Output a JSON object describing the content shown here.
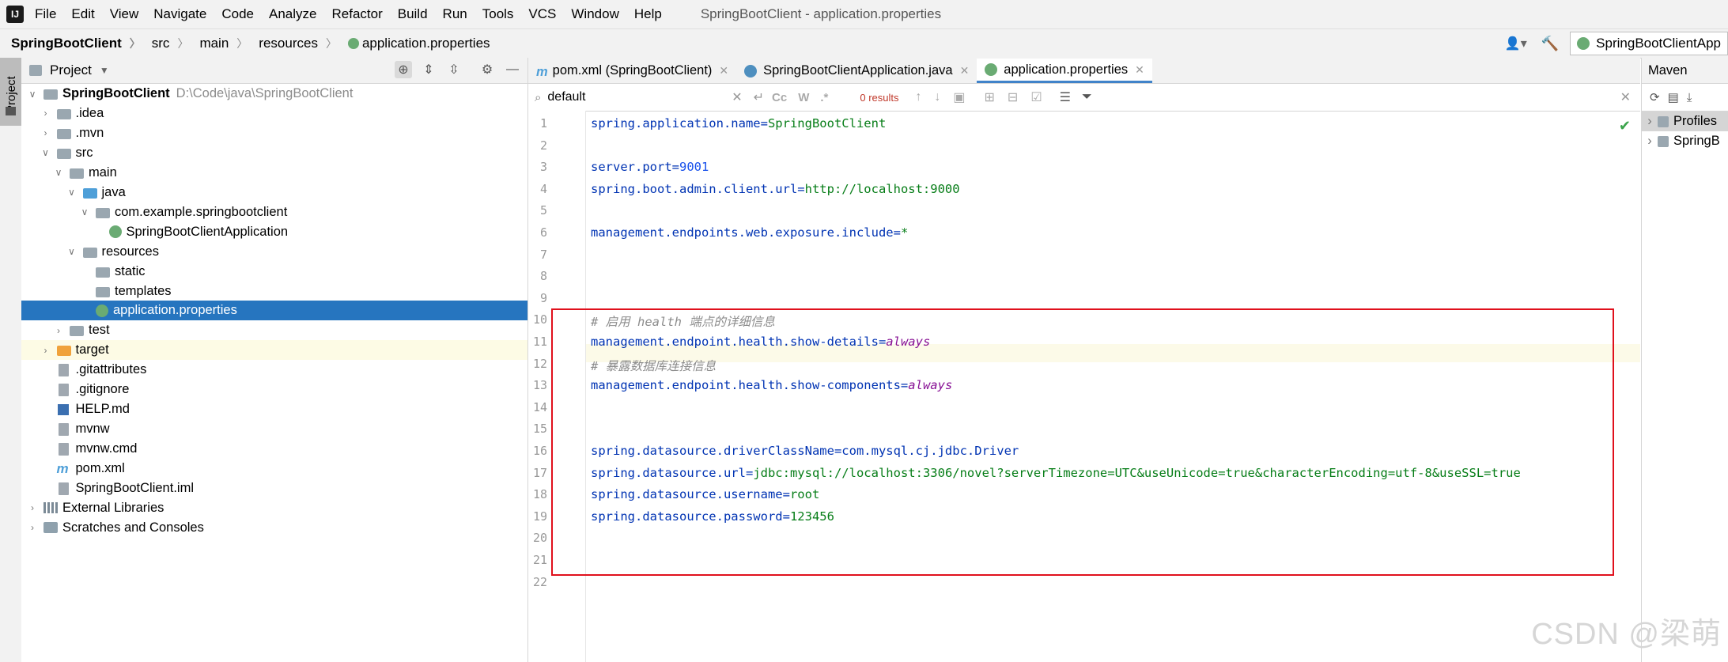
{
  "menubar": {
    "logo": "IJ",
    "items": [
      "File",
      "Edit",
      "View",
      "Navigate",
      "Code",
      "Analyze",
      "Refactor",
      "Build",
      "Run",
      "Tools",
      "VCS",
      "Window",
      "Help"
    ],
    "title": "SpringBootClient - application.properties"
  },
  "breadcrumb": [
    "SpringBootClient",
    "src",
    "main",
    "resources",
    "application.properties"
  ],
  "run_config": "SpringBootClientApp",
  "project_panel": {
    "title": "Project",
    "left_tab": "Project",
    "tree": [
      {
        "label": "SpringBootClient",
        "path": "D:\\Code\\java\\SpringBootClient",
        "depth": 0,
        "arrow": "▾",
        "icon": "folder"
      },
      {
        "label": ".idea",
        "depth": 1,
        "arrow": "▸",
        "icon": "folder"
      },
      {
        "label": ".mvn",
        "depth": 1,
        "arrow": "▸",
        "icon": "folder"
      },
      {
        "label": "src",
        "depth": 1,
        "arrow": "▾",
        "icon": "folder"
      },
      {
        "label": "main",
        "depth": 2,
        "arrow": "▾",
        "icon": "folder"
      },
      {
        "label": "java",
        "depth": 3,
        "arrow": "▾",
        "icon": "folder-blue"
      },
      {
        "label": "com.example.springbootclient",
        "depth": 4,
        "arrow": "▾",
        "icon": "folder"
      },
      {
        "label": "SpringBootClientApplication",
        "depth": 5,
        "arrow": "",
        "icon": "spring-class"
      },
      {
        "label": "resources",
        "depth": 3,
        "arrow": "▾",
        "icon": "folder"
      },
      {
        "label": "static",
        "depth": 4,
        "arrow": "",
        "icon": "folder"
      },
      {
        "label": "templates",
        "depth": 4,
        "arrow": "",
        "icon": "folder"
      },
      {
        "label": "application.properties",
        "depth": 4,
        "arrow": "",
        "icon": "spring-props",
        "selected": true
      },
      {
        "label": "test",
        "depth": 2,
        "arrow": "▸",
        "icon": "folder"
      },
      {
        "label": "target",
        "depth": 1,
        "arrow": "▸",
        "icon": "folder-orange",
        "highlight": true
      },
      {
        "label": ".gitattributes",
        "depth": 1,
        "arrow": "",
        "icon": "file"
      },
      {
        "label": ".gitignore",
        "depth": 1,
        "arrow": "",
        "icon": "file"
      },
      {
        "label": "HELP.md",
        "depth": 1,
        "arrow": "",
        "icon": "md-file"
      },
      {
        "label": "mvnw",
        "depth": 1,
        "arrow": "",
        "icon": "file"
      },
      {
        "label": "mvnw.cmd",
        "depth": 1,
        "arrow": "",
        "icon": "file"
      },
      {
        "label": "pom.xml",
        "depth": 1,
        "arrow": "",
        "icon": "maven-file"
      },
      {
        "label": "SpringBootClient.iml",
        "depth": 1,
        "arrow": "",
        "icon": "file"
      },
      {
        "label": "External Libraries",
        "depth": 0,
        "arrow": "▸",
        "icon": "libraries"
      },
      {
        "label": "Scratches and Consoles",
        "depth": 0,
        "arrow": "▸",
        "icon": "scratches"
      }
    ]
  },
  "tabs": [
    {
      "label": "pom.xml (SpringBootClient)",
      "icon": "maven-icon",
      "active": false
    },
    {
      "label": "SpringBootClientApplication.java",
      "icon": "spring-class-icon",
      "active": false
    },
    {
      "label": "application.properties",
      "icon": "spring-props-icon",
      "active": true
    }
  ],
  "find": {
    "value": "default",
    "results": "0 results",
    "toggles": [
      "Cc",
      "W",
      ".*"
    ]
  },
  "code_lines": [
    {
      "n": "1",
      "parts": [
        [
          "key",
          "spring.application.name="
        ],
        [
          "val",
          "SpringBootClient"
        ]
      ]
    },
    {
      "n": "2",
      "parts": []
    },
    {
      "n": "3",
      "parts": [
        [
          "key",
          "server.port="
        ],
        [
          "num",
          "9001"
        ]
      ]
    },
    {
      "n": "4",
      "parts": [
        [
          "key",
          "spring.boot.admin.client.url="
        ],
        [
          "val",
          "http://localhost:9000"
        ]
      ]
    },
    {
      "n": "5",
      "parts": []
    },
    {
      "n": "6",
      "parts": [
        [
          "key",
          "management.endpoints.web.exposure.include="
        ],
        [
          "val",
          "*"
        ]
      ]
    },
    {
      "n": "7",
      "parts": []
    },
    {
      "n": "8",
      "parts": []
    },
    {
      "n": "9",
      "parts": []
    },
    {
      "n": "10",
      "parts": [
        [
          "cmt",
          "# 启用 health 端点的详细信息"
        ]
      ]
    },
    {
      "n": "11",
      "parts": [
        [
          "key",
          "management.endpoint.health.show-details="
        ],
        [
          "kw",
          "always"
        ]
      ]
    },
    {
      "n": "12",
      "parts": [
        [
          "cmt",
          "# 暴露数据库连接信息"
        ]
      ]
    },
    {
      "n": "13",
      "parts": [
        [
          "key",
          "management.endpoint.health.show-components="
        ],
        [
          "kw",
          "always"
        ]
      ]
    },
    {
      "n": "14",
      "parts": []
    },
    {
      "n": "15",
      "parts": []
    },
    {
      "n": "16",
      "parts": [
        [
          "key",
          "spring.datasource.driverClassName="
        ],
        [
          "plain",
          "com.mysql.cj.jdbc.Driver"
        ]
      ]
    },
    {
      "n": "17",
      "parts": [
        [
          "key",
          "spring.datasource.url="
        ],
        [
          "val",
          "jdbc:mysql://localhost:3306/novel?serverTimezone=UTC&useUnicode=true&characterEncoding=utf-8&useSSL=true"
        ]
      ]
    },
    {
      "n": "18",
      "parts": [
        [
          "key",
          "spring.datasource.username="
        ],
        [
          "val",
          "root"
        ]
      ]
    },
    {
      "n": "19",
      "parts": [
        [
          "key",
          "spring.datasource.password="
        ],
        [
          "val",
          "123456"
        ]
      ]
    },
    {
      "n": "20",
      "parts": []
    },
    {
      "n": "21",
      "parts": []
    },
    {
      "n": "22",
      "parts": []
    }
  ],
  "maven": {
    "title": "Maven",
    "rows": [
      {
        "label": "Profiles",
        "selected": true
      },
      {
        "label": "SpringB",
        "selected": false
      }
    ]
  },
  "watermark": "CSDN @梁萌",
  "colors": {
    "accent": "#2675bf",
    "highlight_box": "#e0101c",
    "tab_underline": "#4083c9"
  }
}
